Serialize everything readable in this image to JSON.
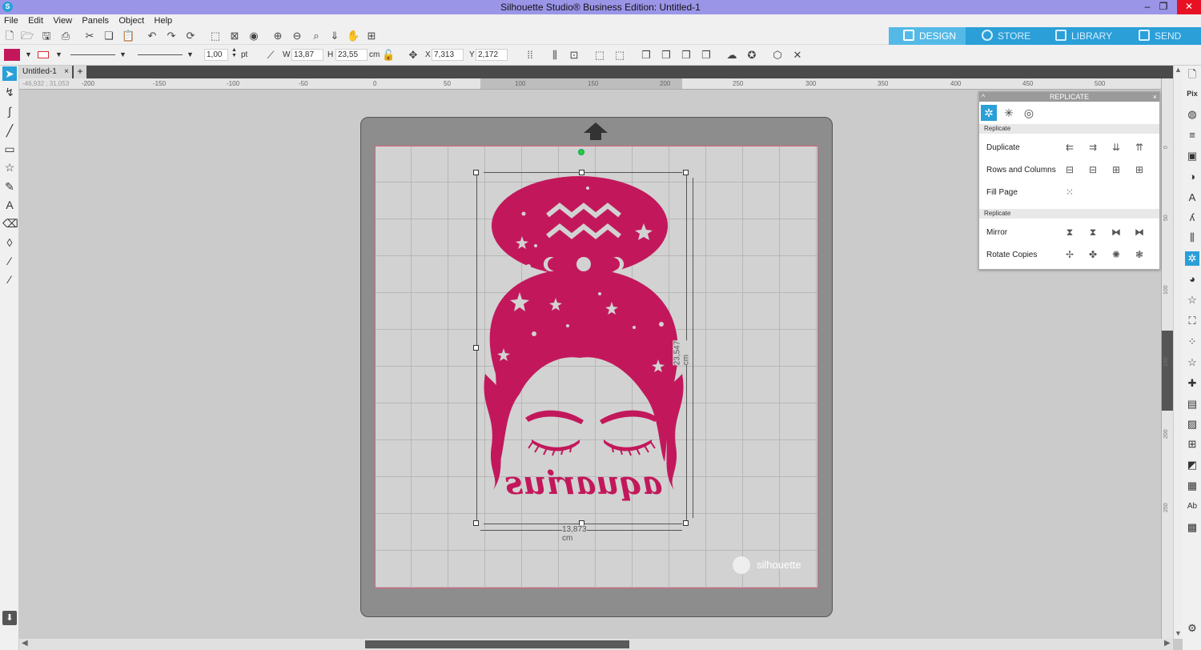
{
  "window": {
    "title": "Silhouette Studio® Business Edition: Untitled-1",
    "controls": [
      "–",
      "❐",
      "✕"
    ]
  },
  "menu": [
    "File",
    "Edit",
    "View",
    "Panels",
    "Object",
    "Help"
  ],
  "nav_tabs": [
    {
      "label": "DESIGN",
      "active": true
    },
    {
      "label": "STORE",
      "active": false
    },
    {
      "label": "LIBRARY",
      "active": false
    },
    {
      "label": "SEND",
      "active": false
    }
  ],
  "props": {
    "fill_color": "#c2185b",
    "stroke_color": "#d32f2f",
    "line_width": "1,00",
    "line_unit": "pt",
    "w_label": "W",
    "w_value": "13,87",
    "h_label": "H",
    "h_value": "23,55",
    "size_unit": "cm",
    "x_label": "X",
    "x_value": "7,313",
    "y_label": "Y",
    "y_value": "2,172"
  },
  "document": {
    "tab": "Untitled-1",
    "add": "+"
  },
  "ruler": {
    "coord_readout": "-46,932 ; 31,053",
    "h_ticks": [
      "-200",
      "-150",
      "-100",
      "-50",
      "0",
      "50",
      "100",
      "150",
      "200",
      "250",
      "300",
      "350",
      "400",
      "450",
      "500"
    ],
    "v_ticks": [
      "0",
      "50",
      "100",
      "150",
      "200",
      "250"
    ]
  },
  "canvas": {
    "artwork_text": "aquarius",
    "artwork_color": "#c2185b",
    "width_dimension": "13,873 cm",
    "height_dimension": "23,547 cm",
    "brand": "silhouette"
  },
  "replicate_panel": {
    "title": "REPLICATE",
    "section1": "Replicate",
    "rows1": [
      "Duplicate",
      "Rows and Columns",
      "Fill Page"
    ],
    "section2": "Replicate",
    "rows2": [
      "Mirror",
      "Rotate Copies"
    ]
  }
}
